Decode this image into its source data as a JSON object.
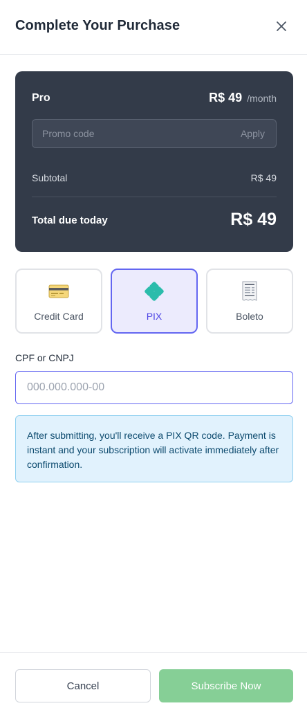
{
  "dialog": {
    "title": "Complete Your Purchase"
  },
  "summary": {
    "plan_name": "Pro",
    "price": "R$ 49",
    "period": "/month",
    "promo_placeholder": "Promo code",
    "promo_apply": "Apply",
    "subtotal_label": "Subtotal",
    "subtotal_value": "R$ 49",
    "total_label": "Total due today",
    "total_value": "R$ 49"
  },
  "payment_methods": [
    {
      "label": "Credit Card",
      "icon": "credit-card-icon",
      "selected": false
    },
    {
      "label": "PIX",
      "icon": "pix-icon",
      "selected": true
    },
    {
      "label": "Boleto",
      "icon": "receipt-icon",
      "selected": false
    }
  ],
  "tax_id": {
    "label": "CPF or CNPJ",
    "placeholder": "000.000.000-00",
    "value": ""
  },
  "info_text": "After submitting, you'll receive a PIX QR code. Payment is instant and your subscription will activate immediately after confirmation.",
  "footer": {
    "cancel_label": "Cancel",
    "subscribe_label": "Subscribe Now"
  },
  "colors": {
    "summary_bg": "#333b49",
    "accent": "#6366f1",
    "selected_bg": "#ecebfd",
    "pix_green": "#2bbcab",
    "info_bg": "#e1f2fd",
    "info_border": "#8fd0f0",
    "subscribe_bg": "#86cf96"
  }
}
